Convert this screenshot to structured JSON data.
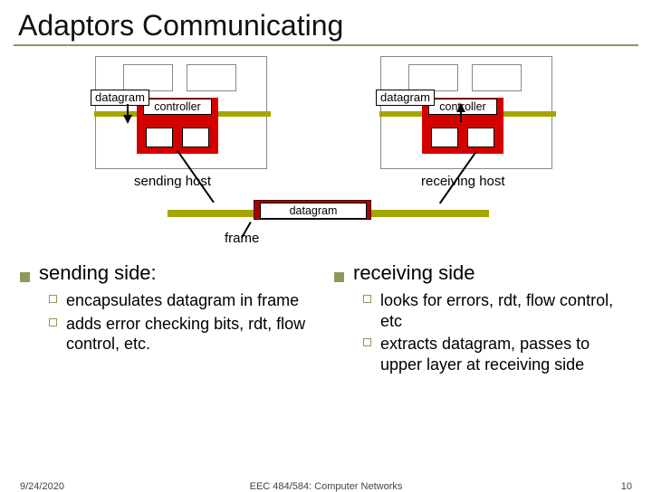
{
  "title": "Adaptors Communicating",
  "diagram": {
    "datagram_label": "datagram",
    "controller_label": "controller",
    "sending_host": "sending host",
    "receiving_host": "receiving host",
    "frame_contents": "datagram",
    "frame_label": "frame"
  },
  "left": {
    "heading": "sending side:",
    "items": [
      "encapsulates datagram in frame",
      "adds error checking bits, rdt, flow control, etc."
    ]
  },
  "right": {
    "heading": "receiving side",
    "items": [
      "looks for errors, rdt, flow control, etc",
      "extracts datagram, passes to upper layer at receiving side"
    ]
  },
  "footer": {
    "date": "9/24/2020",
    "course": "EEC 484/584: Computer Networks",
    "page": "10"
  }
}
